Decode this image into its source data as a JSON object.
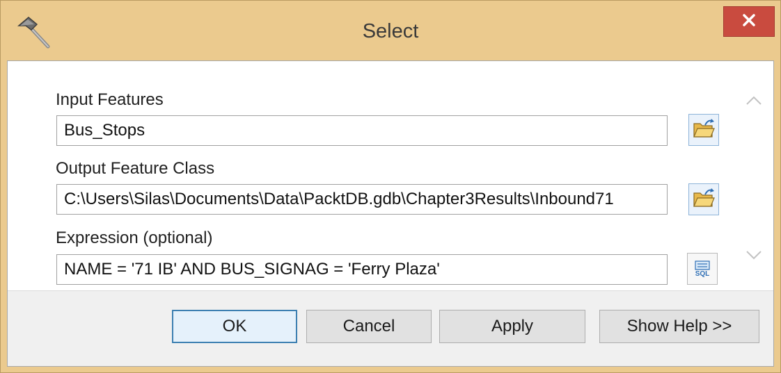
{
  "window": {
    "title": "Select",
    "app_icon": "hammer-icon",
    "close_icon": "close-icon",
    "titlebar_color": "#ebca8e",
    "close_color": "#c94b3f"
  },
  "form": {
    "input_features": {
      "label": "Input Features",
      "value": "Bus_Stops",
      "browse_icon": "open-folder-icon"
    },
    "output_feature_class": {
      "label": "Output Feature Class",
      "value": "C:\\Users\\Silas\\Documents\\Data\\PacktDB.gdb\\Chapter3Results\\Inbound71",
      "browse_icon": "open-folder-icon"
    },
    "expression": {
      "label": "Expression (optional)",
      "value": "NAME = '71 IB' AND BUS_SIGNAG = 'Ferry Plaza'",
      "sql_icon": "sql-icon",
      "sql_text": "SQL"
    }
  },
  "buttons": {
    "ok": "OK",
    "cancel": "Cancel",
    "apply": "Apply",
    "help": "Show Help >>"
  }
}
